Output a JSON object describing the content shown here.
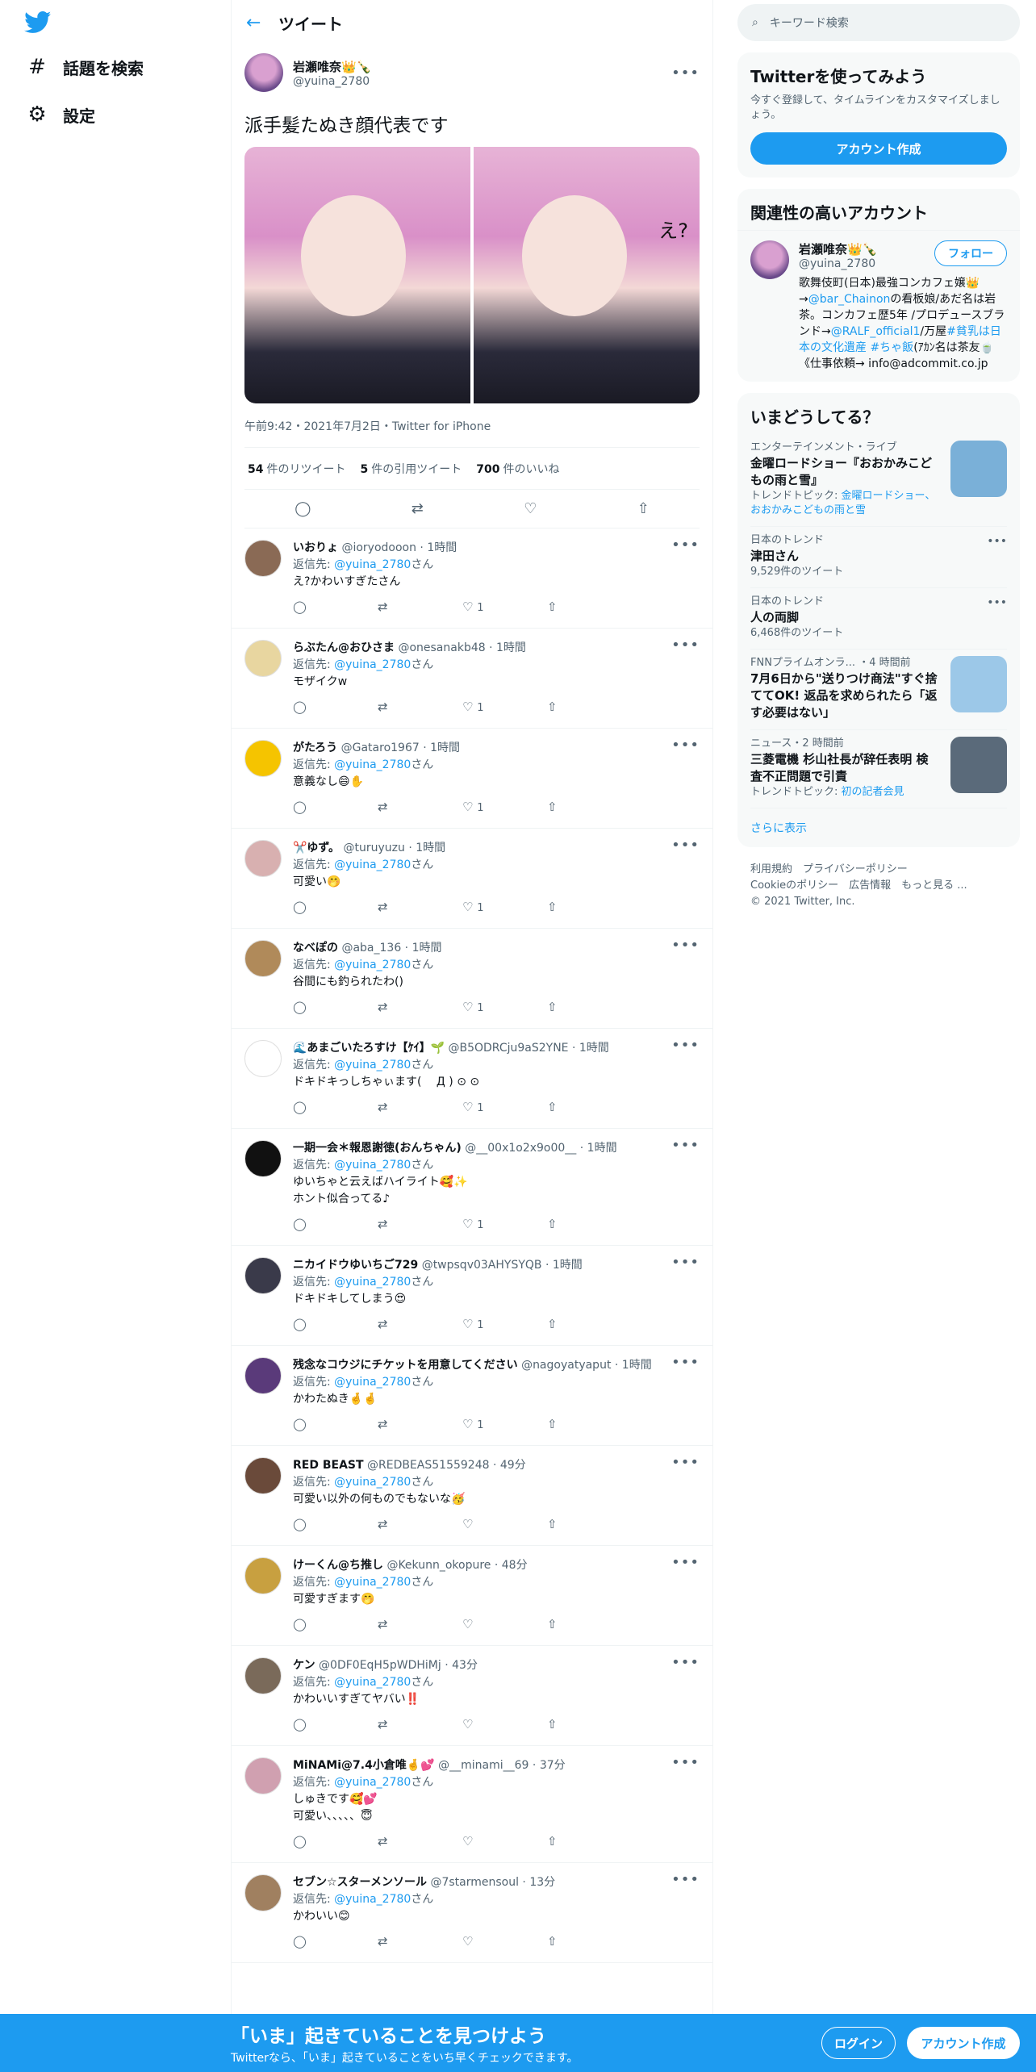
{
  "nav": {
    "explore": "話題を検索",
    "settings": "設定"
  },
  "header": {
    "back": "←",
    "title": "ツイート"
  },
  "main_tweet": {
    "name": "岩瀬唯奈👑🍾",
    "handle": "@yuina_2780",
    "text": "派手髪たぬき顔代表です",
    "photo_overlay": "え?",
    "meta": "午前9:42・2021年7月2日・Twitter for iPhone",
    "retweets_num": "54",
    "retweets_label": "件のリツイート",
    "quotes_num": "5",
    "quotes_label": "件の引用ツイート",
    "likes_num": "700",
    "likes_label": "件のいいね"
  },
  "reply_to_label": "返信先:",
  "reply_to_handle": "@yuina_2780",
  "reply_to_suffix": "さん",
  "replies": [
    {
      "name": "いおりょ",
      "handle": "@ioryodooon",
      "time": "1時間",
      "text": "え?かわいすぎたさん",
      "likes": "1",
      "avatar": "#8a6a55"
    },
    {
      "name": "らぶたん@おひさま",
      "handle": "@onesanakb48",
      "time": "1時間",
      "text": "モザイクw",
      "likes": "1",
      "avatar": "#e8d6a0"
    },
    {
      "name": "がたろう",
      "handle": "@Gataro1967",
      "time": "1時間",
      "text": "意義なし😄✋",
      "likes": "1",
      "avatar": "#f5c400"
    },
    {
      "name": "✂️ゆず。",
      "handle": "@turuyuzu",
      "time": "1時間",
      "text": "可愛い🤭",
      "likes": "1",
      "avatar": "#d8b0b0"
    },
    {
      "name": "なべぽの",
      "handle": "@aba_136",
      "time": "1時間",
      "text": "谷間にも釣られたわ()",
      "likes": "1",
      "avatar": "#b08a5a"
    },
    {
      "name": "🌊あまごいたろすけ【ｹｲ】🌱",
      "handle": "@B5ODRCju9aS2YNE",
      "time": "1時間",
      "text": "ドキドキっしちゃぃます( 　Д ) ⊙ ⊙",
      "likes": "1",
      "avatar": "#ffffff"
    },
    {
      "name": "一期一会＊報恩謝徳(おんちゃん)",
      "handle": "@__00x1o2x9o00__",
      "time": "1時間",
      "text": "ゆいちゃと云えばハイライト🥰✨",
      "text2": "ホント似合ってる♪",
      "likes": "1",
      "avatar": "#111111"
    },
    {
      "name": "ニカイドウゆいちご729",
      "handle": "@twpsqv03AHYSYQB",
      "time": "1時間",
      "text": "ドキドキしてしまう😍",
      "likes": "1",
      "avatar": "#3a3a4a"
    },
    {
      "name": "残念なコウジにチケットを用意してください",
      "handle": "@nagoyatyaput",
      "time": "1時間",
      "text": "かわたぬき🤞🤞",
      "likes": "1",
      "avatar": "#5a3a7a"
    },
    {
      "name": "RED BEAST",
      "handle": "@REDBEAS51559248",
      "time": "49分",
      "text": "可愛い以外の何ものでもないな🥳",
      "likes": "",
      "avatar": "#6a4a3a"
    },
    {
      "name": "けーくん@ち推し",
      "handle": "@Kekunn_okopure",
      "time": "48分",
      "text": "可愛すぎます🤭",
      "likes": "",
      "avatar": "#c8a040"
    },
    {
      "name": "ケン",
      "handle": "@0DF0EqH5pWDHiMj",
      "time": "43分",
      "text": "かわいいすぎてヤバい‼️",
      "likes": "",
      "avatar": "#7a6a5a"
    },
    {
      "name": "MiNAMi@7.4小倉唯🤞💕",
      "handle": "@__minami__69",
      "time": "37分",
      "text": "しゅきです🥰💕",
      "text2": "可愛い、、、、、😇",
      "likes": "",
      "avatar": "#d0a0b0"
    },
    {
      "name": "セブン☆スターメンソール",
      "handle": "@7starmensoul",
      "time": "13分",
      "text": "かわいい😊",
      "likes": "",
      "avatar": "#a08060"
    }
  ],
  "right": {
    "search_placeholder": "キーワード検索",
    "signup_title": "Twitterを使ってみよう",
    "signup_desc": "今すぐ登録して、タイムラインをカスタマイズしましょう。",
    "signup_btn": "アカウント作成",
    "related_title": "関連性の高いアカウント",
    "rel_name": "岩瀬唯奈👑🍾",
    "rel_handle": "@yuina_2780",
    "follow_btn": "フォロー",
    "bio_1": "歌舞伎町(日本)最強コンカフェ嬢👑→",
    "bio_link_1": "@bar_Chainon",
    "bio_2": "の看板娘/あだ名は岩茶。コンカフェ歴5年 /プロデュースブランド→",
    "bio_link_2": "@RALF_official1",
    "bio_3": "/万屋",
    "bio_link_3": "#貧乳は日本の文化遺産 #ちゃ飯",
    "bio_4": "(ｱｶﾝ名は茶友🍵《仕事依頼→ info@adcommit.co.jp",
    "trends_title": "いまどうしてる？",
    "trends": [
      {
        "sub": "エンターテインメント・ライブ",
        "title": "金曜ロードショー『おおかみこどもの雨と雪』",
        "topic_label": "トレンドトピック:",
        "topic": "金曜ロードショー、おおかみこどもの雨と雪",
        "img": "#7ab0d8"
      },
      {
        "sub": "日本のトレンド",
        "title": "津田さん",
        "count": "9,529件のツイート"
      },
      {
        "sub": "日本のトレンド",
        "title": "人の両脚",
        "count": "6,468件のツイート"
      },
      {
        "sub": "FNNプライムオンラ... ・4 時間前",
        "title": "7月6日から\"送りつけ商法\"すぐ捨ててOK! 返品を求められたら「返す必要はない」",
        "img": "#9cc8e8"
      },
      {
        "sub": "ニュース・2 時間前",
        "title": "三菱電機 杉山社長が辞任表明 検査不正問題で引責",
        "topic_label": "トレンドトピック:",
        "topic": "初の記者会見",
        "img": "#5a6a7a"
      }
    ],
    "show_more": "さらに表示",
    "footer_1": "利用規約　プライバシーポリシー",
    "footer_2": "Cookieのポリシー　広告情報　もっと見る ...",
    "footer_3": "© 2021 Twitter, Inc."
  },
  "bottom": {
    "title": "「いま」起きていることを見つけよう",
    "sub": "Twitterなら、「いま」起きていることをいち早くチェックできます。",
    "login": "ログイン",
    "signup": "アカウント作成"
  },
  "colors": {
    "accent": "#1d9bf0",
    "text": "#0f1419",
    "muted": "#536471"
  }
}
